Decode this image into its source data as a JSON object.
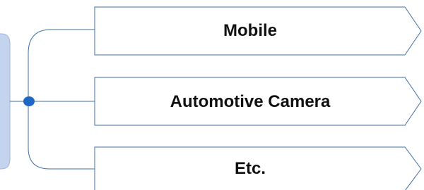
{
  "diagram": {
    "nodes": [
      {
        "label": "Mobile"
      },
      {
        "label": "Automotive Camera"
      },
      {
        "label": "Etc."
      }
    ]
  },
  "colors": {
    "connector": "#3f6fa5",
    "node_border": "#3f6fa5",
    "junction": "#1f67c4",
    "source_fill": "#c4d4ee",
    "source_border": "#9fb6de",
    "text": "#111111"
  }
}
